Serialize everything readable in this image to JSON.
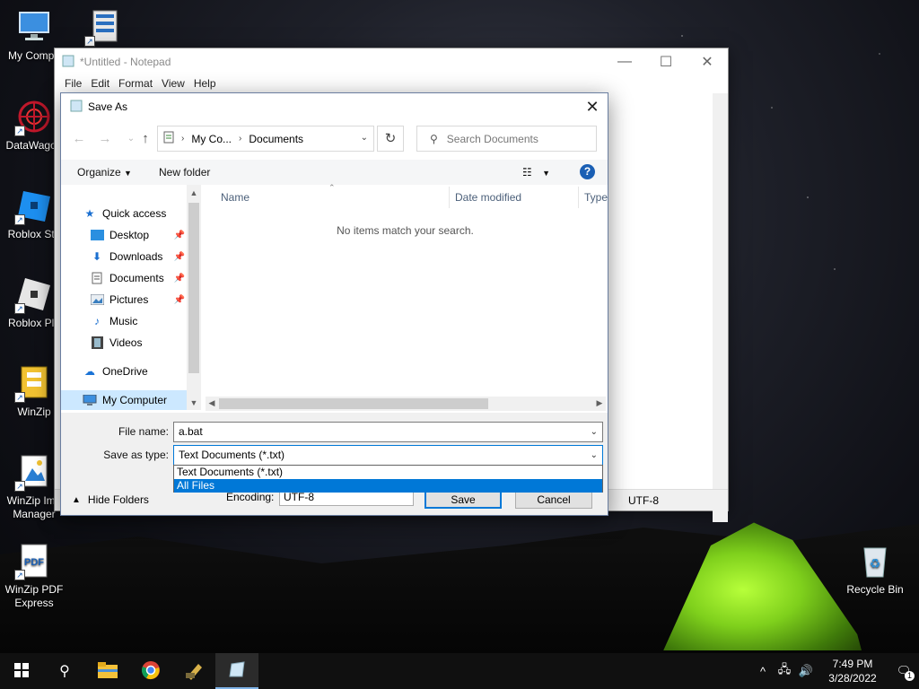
{
  "desktop": {
    "icons": [
      {
        "label": "My Compu"
      },
      {
        "label": "DataWagon"
      },
      {
        "label": "Roblox Stu"
      },
      {
        "label": "Roblox Pla"
      },
      {
        "label": "WinZip"
      },
      {
        "label": "WinZip Ima Manager"
      },
      {
        "label": "WinZip PDF Express"
      },
      {
        "label": "Recycle Bin"
      }
    ]
  },
  "notepad": {
    "title": "*Untitled - Notepad",
    "menu": [
      "File",
      "Edit",
      "Format",
      "View",
      "Help"
    ],
    "status_encoding": "UTF-8"
  },
  "dialog": {
    "title": "Save As",
    "breadcrumb": [
      "My Co...",
      "Documents"
    ],
    "search_placeholder": "Search Documents",
    "organize_label": "Organize",
    "new_folder_label": "New folder",
    "nav": {
      "quick_access": "Quick access",
      "desktop": "Desktop",
      "downloads": "Downloads",
      "documents": "Documents",
      "pictures": "Pictures",
      "music": "Music",
      "videos": "Videos",
      "onedrive": "OneDrive",
      "my_computer": "My Computer"
    },
    "columns": {
      "name": "Name",
      "date_modified": "Date modified",
      "type": "Type"
    },
    "empty_message": "No items match your search.",
    "file_name_label": "File name:",
    "file_name_value": "a.bat",
    "save_type_label": "Save as type:",
    "save_type_value": "Text Documents (*.txt)",
    "save_type_options": [
      "Text Documents (*.txt)",
      "All Files"
    ],
    "hide_folders_label": "Hide Folders",
    "encoding_label": "Encoding:",
    "encoding_value": "UTF-8",
    "save_label": "Save",
    "cancel_label": "Cancel"
  },
  "taskbar": {
    "time": "7:49 PM",
    "date": "3/28/2022",
    "notification_count": "1"
  },
  "colors": {
    "accent": "#0078d7",
    "selection": "#cce8ff",
    "tent": "#8fe02a"
  }
}
